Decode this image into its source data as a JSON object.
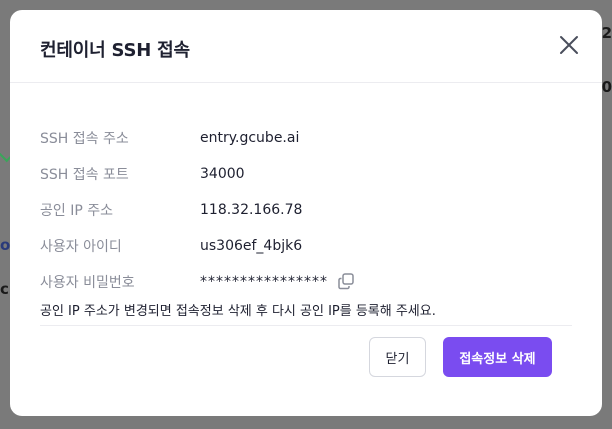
{
  "backdrop": {
    "text_1": "2",
    "text_2": "0",
    "text_3": "o.",
    "text_4": "c"
  },
  "modal": {
    "title": "컨테이너 SSH 접속",
    "rows": [
      {
        "label": "SSH 접속 주소",
        "value": "entry.gcube.ai"
      },
      {
        "label": "SSH 접속 포트",
        "value": "34000"
      },
      {
        "label": "공인 IP 주소",
        "value": "118.32.166.78"
      },
      {
        "label": "사용자 아이디",
        "value": "us306ef_4bjk6"
      },
      {
        "label": "사용자 비밀번호",
        "value": "****************"
      }
    ],
    "notice": "공인 IP 주소가 변경되면 접속정보 삭제 후 다시 공인 IP를 등록해 주세요.",
    "close_button_label": "닫기",
    "delete_button_label": "접속정보 삭제"
  },
  "colors": {
    "accent": "#7a4cf0",
    "text_primary": "#1e2030",
    "text_secondary": "#8a8d99"
  },
  "icons": {
    "close": "close-icon",
    "copy": "copy-icon"
  }
}
